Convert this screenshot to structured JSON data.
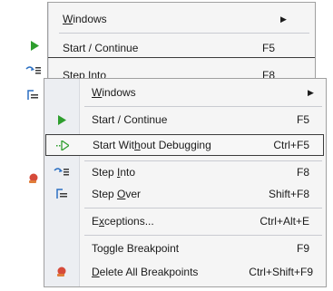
{
  "back_menu": {
    "items": [
      {
        "id": "windows",
        "label": "Windows",
        "shortcut": "",
        "submenu": true
      },
      {
        "id": "start-continue",
        "label": "Start / Continue",
        "shortcut": "F5"
      },
      {
        "id": "step-into",
        "label": "Step Into",
        "shortcut": "F8"
      }
    ]
  },
  "front_menu": {
    "items": [
      {
        "id": "windows",
        "label": "Windows",
        "shortcut": "",
        "submenu": true,
        "icon": "none"
      },
      {
        "id": "start-continue",
        "label": "Start / Continue",
        "shortcut": "F5",
        "icon": "play-icon"
      },
      {
        "id": "start-without-debugging",
        "label": "Start Without Debugging",
        "shortcut": "Ctrl+F5",
        "icon": "run-without-debug-icon",
        "highlighted": true
      },
      {
        "id": "step-into",
        "label": "Step Into",
        "shortcut": "F8",
        "icon": "step-into-icon"
      },
      {
        "id": "step-over",
        "label": "Step Over",
        "shortcut": "Shift+F8",
        "icon": "step-over-icon"
      },
      {
        "id": "exceptions",
        "label": "Exceptions...",
        "shortcut": "Ctrl+Alt+E",
        "icon": "none"
      },
      {
        "id": "toggle-breakpoint",
        "label": "Toggle Breakpoint",
        "shortcut": "F9",
        "icon": "none"
      },
      {
        "id": "delete-all-breakpoints",
        "label": "Delete All Breakpoints",
        "shortcut": "Ctrl+Shift+F9",
        "icon": "delete-breakpoints-icon"
      }
    ]
  },
  "colors": {
    "play_green": "#2e9e2e",
    "highlight_border": "#3c3c3c",
    "menu_background": "#f5f5f5",
    "gutter": "#eceef2"
  }
}
